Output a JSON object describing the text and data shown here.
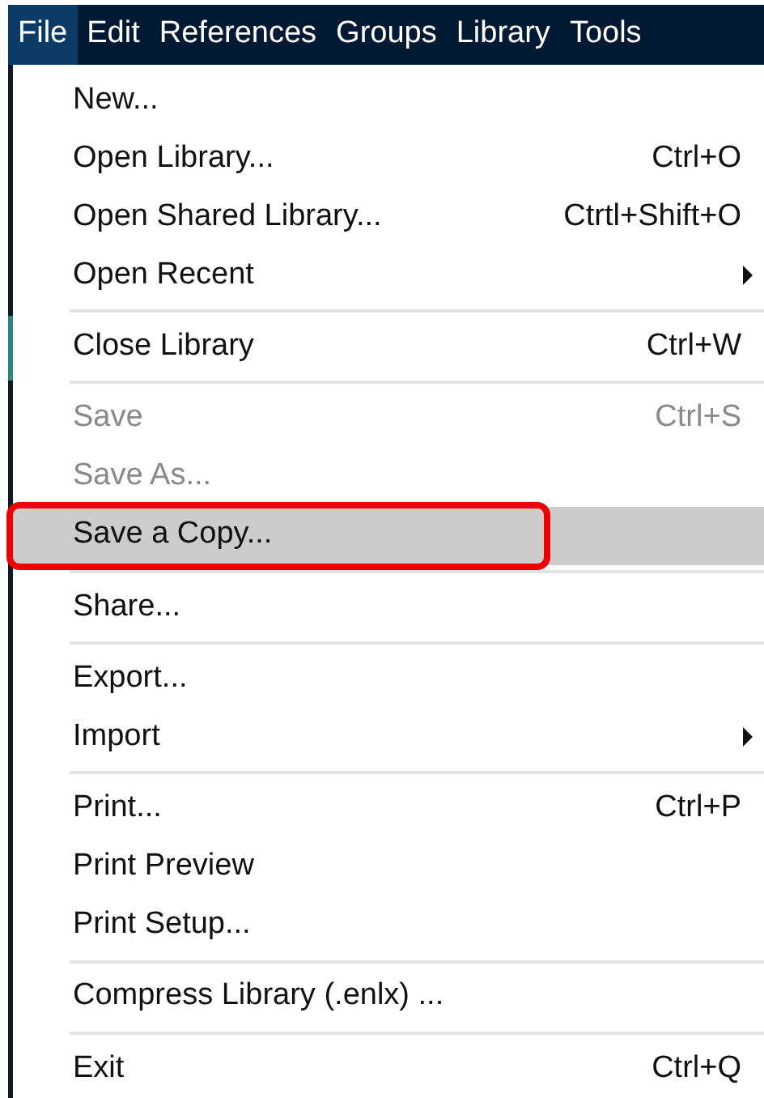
{
  "menubar": [
    {
      "label": "File",
      "selected": true
    },
    {
      "label": "Edit",
      "selected": false
    },
    {
      "label": "References",
      "selected": false
    },
    {
      "label": "Groups",
      "selected": false
    },
    {
      "label": "Library",
      "selected": false
    },
    {
      "label": "Tools",
      "selected": false
    }
  ],
  "menu": [
    {
      "kind": "item",
      "label": "New...",
      "disabled": false,
      "selected": false
    },
    {
      "kind": "item",
      "label": "Open Library...",
      "shortcut": "Ctrl+O",
      "disabled": false,
      "selected": false
    },
    {
      "kind": "item",
      "label": "Open Shared Library...",
      "shortcut": "Ctrtl+Shift+O",
      "disabled": false,
      "selected": false
    },
    {
      "kind": "item",
      "label": "Open Recent",
      "submenu": true,
      "disabled": false,
      "selected": false
    },
    {
      "kind": "separator"
    },
    {
      "kind": "item",
      "label": "Close Library",
      "shortcut": "Ctrl+W",
      "disabled": false,
      "selected": false
    },
    {
      "kind": "separator"
    },
    {
      "kind": "item",
      "label": "Save",
      "shortcut": "Ctrl+S",
      "disabled": true,
      "selected": false
    },
    {
      "kind": "item",
      "label": "Save As...",
      "disabled": true,
      "selected": false
    },
    {
      "kind": "item",
      "label": "Save a Copy...",
      "disabled": false,
      "selected": true,
      "annotated": true
    },
    {
      "kind": "separator"
    },
    {
      "kind": "item",
      "label": "Share...",
      "disabled": false,
      "selected": false
    },
    {
      "kind": "separator"
    },
    {
      "kind": "item",
      "label": "Export...",
      "disabled": false,
      "selected": false
    },
    {
      "kind": "item",
      "label": "Import",
      "submenu": true,
      "disabled": false,
      "selected": false
    },
    {
      "kind": "separator"
    },
    {
      "kind": "item",
      "label": "Print...",
      "shortcut": "Ctrl+P",
      "disabled": false,
      "selected": false
    },
    {
      "kind": "item",
      "label": "Print Preview",
      "disabled": false,
      "selected": false
    },
    {
      "kind": "item",
      "label": "Print Setup...",
      "disabled": false,
      "selected": false
    },
    {
      "kind": "separator"
    },
    {
      "kind": "item",
      "label": "Compress Library (.enlx) ...",
      "disabled": false,
      "selected": false
    },
    {
      "kind": "separator"
    },
    {
      "kind": "item",
      "label": "Exit",
      "shortcut": "Ctrl+Q",
      "disabled": false,
      "selected": false
    }
  ]
}
